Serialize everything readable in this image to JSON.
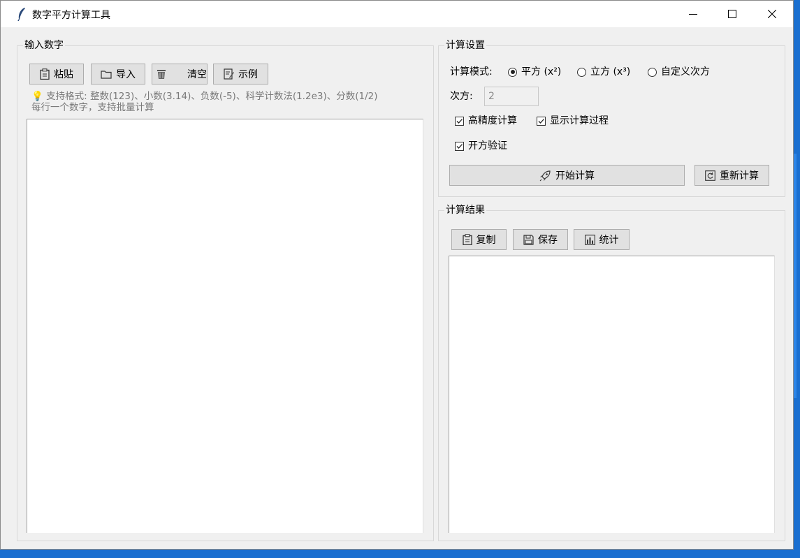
{
  "window": {
    "title": "数字平方计算工具"
  },
  "input_group": {
    "title": "输入数字",
    "buttons": {
      "paste": "粘贴",
      "import": "导入",
      "clear": "清空",
      "example": "示例"
    },
    "hint_line1": "💡 支持格式: 整数(123)、小数(3.14)、负数(-5)、科学计数法(1.2e3)、分数(1/2)",
    "hint_line2": "每行一个数字，支持批量计算"
  },
  "settings_group": {
    "title": "计算设置",
    "mode_label": "计算模式:",
    "modes": [
      "平方 (x²)",
      "立方 (x³)",
      "自定义次方"
    ],
    "selected_mode": "平方 (x²)",
    "power_label": "次方:",
    "power_value": "2",
    "options": {
      "high_precision": "高精度计算",
      "show_process": "显示计算过程",
      "sqrt_verify": "开方验证"
    },
    "start_button": "开始计算",
    "recalc_button": "重新计算"
  },
  "result_group": {
    "title": "计算结果",
    "buttons": {
      "copy": "复制",
      "save": "保存",
      "stats": "统计"
    }
  }
}
